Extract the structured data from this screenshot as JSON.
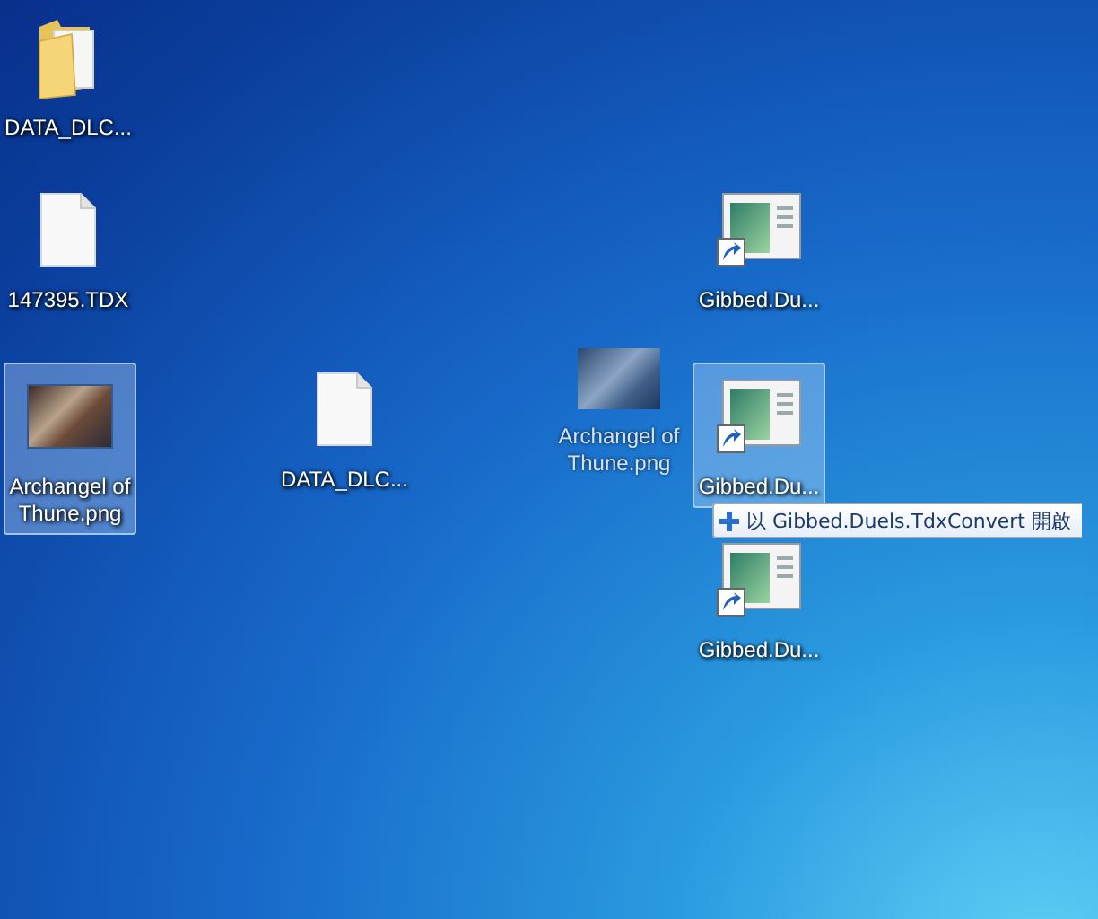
{
  "desktop": {
    "items": [
      {
        "label": "DATA_DLC...",
        "kind": "folder",
        "selected": false
      },
      {
        "label": "147395.TDX",
        "kind": "file",
        "selected": false
      },
      {
        "label": "Archangel of Thune.png",
        "kind": "image",
        "selected": true
      },
      {
        "label": "DATA_DLC...",
        "kind": "file",
        "selected": false
      },
      {
        "label": "Gibbed.Du...",
        "kind": "shortcut",
        "selected": false
      },
      {
        "label": "Gibbed.Du...",
        "kind": "shortcut",
        "selected": true
      },
      {
        "label": "Gibbed.Du...",
        "kind": "shortcut",
        "selected": false
      }
    ]
  },
  "drag_preview": {
    "label": "Archangel of Thune.png"
  },
  "drop_tooltip": {
    "text": "以 Gibbed.Duels.TdxConvert 開啟"
  }
}
